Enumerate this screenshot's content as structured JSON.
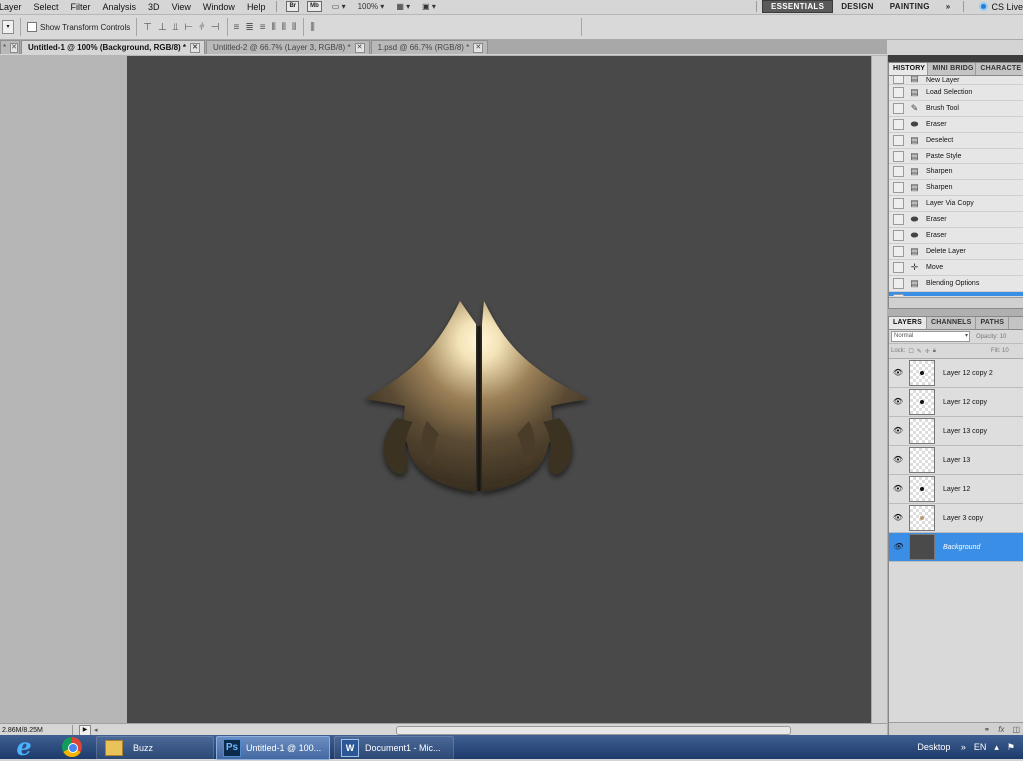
{
  "menubar": {
    "items": [
      "Layer",
      "Select",
      "Filter",
      "Analysis",
      "3D",
      "View",
      "Window",
      "Help"
    ],
    "bridge_button": "Br",
    "minibridge_button": "Mb",
    "zoom": "100%",
    "workspaces": [
      "ESSENTIALS",
      "DESIGN",
      "PAINTING",
      "»"
    ],
    "cs_live": "CS Live"
  },
  "options": {
    "show_transform_label": "Show Transform Controls"
  },
  "tabs": [
    {
      "label": "Untitled-1 @ 100% (Background, RGB/8) *",
      "active": true
    },
    {
      "label": "Untitled-2 @ 66.7% (Layer 3, RGB/8) *",
      "active": false
    },
    {
      "label": "1.psd @ 66.7% (RGB/8) *",
      "active": false
    }
  ],
  "status": {
    "doc_size": "2.86M/8.25M"
  },
  "history_panel": {
    "tabs": [
      "HISTORY",
      "MINI BRIDG",
      "CHARACTE"
    ],
    "items": [
      {
        "label": "New Layer",
        "icon": "document-step-icon"
      },
      {
        "label": "Load Selection",
        "icon": "document-step-icon"
      },
      {
        "label": "Brush Tool",
        "icon": "brush-icon"
      },
      {
        "label": "Eraser",
        "icon": "eraser-icon"
      },
      {
        "label": "Deselect",
        "icon": "document-step-icon"
      },
      {
        "label": "Paste Style",
        "icon": "document-step-icon"
      },
      {
        "label": "Sharpen",
        "icon": "document-step-icon"
      },
      {
        "label": "Sharpen",
        "icon": "document-step-icon"
      },
      {
        "label": "Layer Via Copy",
        "icon": "document-step-icon"
      },
      {
        "label": "Eraser",
        "icon": "eraser-icon"
      },
      {
        "label": "Eraser",
        "icon": "eraser-icon"
      },
      {
        "label": "Delete Layer",
        "icon": "document-step-icon"
      },
      {
        "label": "Move",
        "icon": "move-icon"
      },
      {
        "label": "Blending Options",
        "icon": "document-step-icon"
      },
      {
        "label": "Delete Layer",
        "icon": "document-step-icon",
        "selected": true
      }
    ]
  },
  "layers_panel": {
    "tabs": [
      "LAYERS",
      "CHANNELS",
      "PATHS"
    ],
    "blend_mode": "Normal",
    "opacity_label": "Opacity:",
    "opacity_value": "10",
    "lock_label": "Lock:",
    "fill_label": "Fill:",
    "fill_value": "10",
    "layers": [
      {
        "name": "Layer 12 copy 2",
        "thumb": "dot"
      },
      {
        "name": "Layer 12 copy",
        "thumb": "dot"
      },
      {
        "name": "Layer 13 copy",
        "thumb": "empty"
      },
      {
        "name": "Layer 13",
        "thumb": "empty"
      },
      {
        "name": "Layer 12",
        "thumb": "dot"
      },
      {
        "name": "Layer 3 copy",
        "thumb": "tan"
      },
      {
        "name": "Background",
        "thumb": "dark",
        "selected": true
      }
    ]
  },
  "taskbar": {
    "buttons": [
      {
        "label": "Buzz",
        "icon": "folder-icon"
      },
      {
        "label": "Untitled-1 @ 100...",
        "icon": "photoshop-icon"
      },
      {
        "label": "Document1 - Mic...",
        "icon": "word-icon"
      }
    ],
    "desktop": "Desktop",
    "lang": "EN"
  },
  "colors": {
    "canvas": "#494949",
    "selection": "#3a8ee6",
    "artwork_highlight": "#f4e3b8",
    "artwork_dark": "#2a2217"
  }
}
